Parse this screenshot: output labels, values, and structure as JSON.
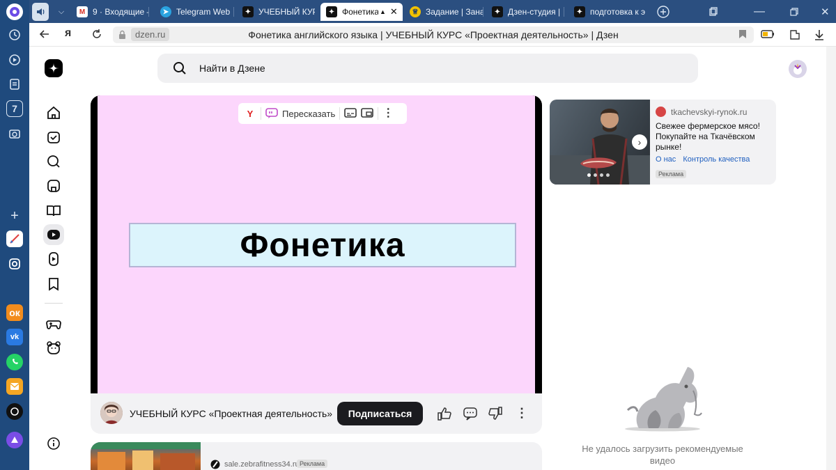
{
  "browser": {
    "tabs": [
      {
        "label": "",
        "icon": "speaker-icon"
      },
      {
        "label": "9 · Входящие –",
        "icon": "gmail-icon"
      },
      {
        "label": "Telegram Web",
        "icon": "telegram-icon"
      },
      {
        "label": "УЧЕБНЫЙ КУР",
        "icon": "dzen-icon"
      },
      {
        "label": "Фонетика",
        "icon": "dzen-icon",
        "active": true
      },
      {
        "label": "Задание | Зана",
        "icon": "emblem-icon"
      },
      {
        "label": "Дзен-студия |",
        "icon": "dzen-icon"
      },
      {
        "label": "подготовка к э",
        "icon": "dzen-icon"
      }
    ],
    "domain": "dzen.ru",
    "page_title": "Фонетика английского языка | УЧЕБНЫЙ КУРС «Проектная деятельность» | Дзен"
  },
  "search": {
    "placeholder": "Найти в Дзене"
  },
  "video": {
    "slide_title": "Фонетика",
    "toolbar": {
      "ya": "Y",
      "retell_label": "Пересказать"
    }
  },
  "channel": {
    "name": "УЧЕБНЫЙ КУРС «Проектная деятельность»",
    "subscribe_label": "Подписаться"
  },
  "ad_right": {
    "site": "tkachevskyi-rynok.ru",
    "text": "Свежее фермерское мясо! Покупайте на Ткачёвском рынке!",
    "link1": "О нас",
    "link2": "Контроль качества",
    "badge": "Реклама"
  },
  "ad_bottom": {
    "site": "sale.zebrafitness34.ru",
    "badge": "Реклама"
  },
  "recommendations": {
    "error": "Не удалось загрузить рекомендуемые видео"
  },
  "colors": {
    "slide_background": "#fcd6fc",
    "slide_title_box": "#dcf4fc",
    "browser_chrome": "#2b4f80",
    "subscribe_button": "#1b1b1f"
  }
}
